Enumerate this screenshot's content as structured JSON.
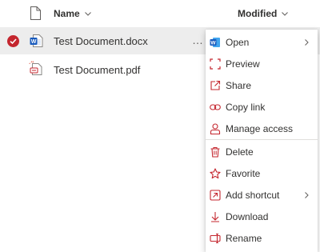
{
  "header": {
    "name_label": "Name",
    "modified_label": "Modified"
  },
  "files": [
    {
      "name": "Test Document.docx",
      "selected": true,
      "icon": "word-doc-icon"
    },
    {
      "name": "Test Document.pdf",
      "selected": false,
      "icon": "pdf-doc-icon"
    }
  ],
  "row_actions_label": "…",
  "context_menu": {
    "items": [
      {
        "label": "Open",
        "icon": "word-icon",
        "submenu": true
      },
      {
        "label": "Preview",
        "icon": "preview-icon",
        "submenu": false
      },
      {
        "label": "Share",
        "icon": "share-icon",
        "submenu": false
      },
      {
        "label": "Copy link",
        "icon": "link-icon",
        "submenu": false
      },
      {
        "label": "Manage access",
        "icon": "person-icon",
        "submenu": false
      },
      {
        "label": "Delete",
        "icon": "trash-icon",
        "submenu": false
      },
      {
        "label": "Favorite",
        "icon": "star-icon",
        "submenu": false
      },
      {
        "label": "Add shortcut",
        "icon": "shortcut-icon",
        "submenu": true
      },
      {
        "label": "Download",
        "icon": "download-icon",
        "submenu": false
      },
      {
        "label": "Rename",
        "icon": "rename-icon",
        "submenu": false
      }
    ]
  },
  "colors": {
    "accent": "#c4262e",
    "selected_row": "#ededed",
    "word_blue": "#185abd",
    "text": "#323130"
  }
}
